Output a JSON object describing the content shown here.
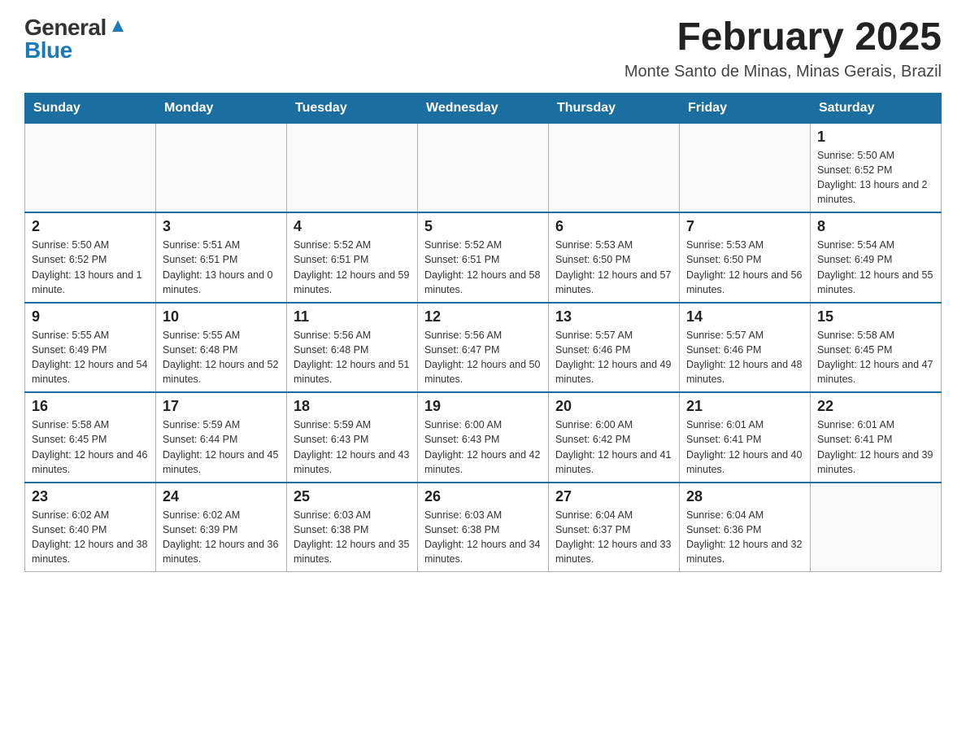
{
  "logo": {
    "general": "General",
    "blue": "Blue"
  },
  "title": "February 2025",
  "location": "Monte Santo de Minas, Minas Gerais, Brazil",
  "days_of_week": [
    "Sunday",
    "Monday",
    "Tuesday",
    "Wednesday",
    "Thursday",
    "Friday",
    "Saturday"
  ],
  "weeks": [
    [
      {
        "day": "",
        "info": ""
      },
      {
        "day": "",
        "info": ""
      },
      {
        "day": "",
        "info": ""
      },
      {
        "day": "",
        "info": ""
      },
      {
        "day": "",
        "info": ""
      },
      {
        "day": "",
        "info": ""
      },
      {
        "day": "1",
        "info": "Sunrise: 5:50 AM\nSunset: 6:52 PM\nDaylight: 13 hours and 2 minutes."
      }
    ],
    [
      {
        "day": "2",
        "info": "Sunrise: 5:50 AM\nSunset: 6:52 PM\nDaylight: 13 hours and 1 minute."
      },
      {
        "day": "3",
        "info": "Sunrise: 5:51 AM\nSunset: 6:51 PM\nDaylight: 13 hours and 0 minutes."
      },
      {
        "day": "4",
        "info": "Sunrise: 5:52 AM\nSunset: 6:51 PM\nDaylight: 12 hours and 59 minutes."
      },
      {
        "day": "5",
        "info": "Sunrise: 5:52 AM\nSunset: 6:51 PM\nDaylight: 12 hours and 58 minutes."
      },
      {
        "day": "6",
        "info": "Sunrise: 5:53 AM\nSunset: 6:50 PM\nDaylight: 12 hours and 57 minutes."
      },
      {
        "day": "7",
        "info": "Sunrise: 5:53 AM\nSunset: 6:50 PM\nDaylight: 12 hours and 56 minutes."
      },
      {
        "day": "8",
        "info": "Sunrise: 5:54 AM\nSunset: 6:49 PM\nDaylight: 12 hours and 55 minutes."
      }
    ],
    [
      {
        "day": "9",
        "info": "Sunrise: 5:55 AM\nSunset: 6:49 PM\nDaylight: 12 hours and 54 minutes."
      },
      {
        "day": "10",
        "info": "Sunrise: 5:55 AM\nSunset: 6:48 PM\nDaylight: 12 hours and 52 minutes."
      },
      {
        "day": "11",
        "info": "Sunrise: 5:56 AM\nSunset: 6:48 PM\nDaylight: 12 hours and 51 minutes."
      },
      {
        "day": "12",
        "info": "Sunrise: 5:56 AM\nSunset: 6:47 PM\nDaylight: 12 hours and 50 minutes."
      },
      {
        "day": "13",
        "info": "Sunrise: 5:57 AM\nSunset: 6:46 PM\nDaylight: 12 hours and 49 minutes."
      },
      {
        "day": "14",
        "info": "Sunrise: 5:57 AM\nSunset: 6:46 PM\nDaylight: 12 hours and 48 minutes."
      },
      {
        "day": "15",
        "info": "Sunrise: 5:58 AM\nSunset: 6:45 PM\nDaylight: 12 hours and 47 minutes."
      }
    ],
    [
      {
        "day": "16",
        "info": "Sunrise: 5:58 AM\nSunset: 6:45 PM\nDaylight: 12 hours and 46 minutes."
      },
      {
        "day": "17",
        "info": "Sunrise: 5:59 AM\nSunset: 6:44 PM\nDaylight: 12 hours and 45 minutes."
      },
      {
        "day": "18",
        "info": "Sunrise: 5:59 AM\nSunset: 6:43 PM\nDaylight: 12 hours and 43 minutes."
      },
      {
        "day": "19",
        "info": "Sunrise: 6:00 AM\nSunset: 6:43 PM\nDaylight: 12 hours and 42 minutes."
      },
      {
        "day": "20",
        "info": "Sunrise: 6:00 AM\nSunset: 6:42 PM\nDaylight: 12 hours and 41 minutes."
      },
      {
        "day": "21",
        "info": "Sunrise: 6:01 AM\nSunset: 6:41 PM\nDaylight: 12 hours and 40 minutes."
      },
      {
        "day": "22",
        "info": "Sunrise: 6:01 AM\nSunset: 6:41 PM\nDaylight: 12 hours and 39 minutes."
      }
    ],
    [
      {
        "day": "23",
        "info": "Sunrise: 6:02 AM\nSunset: 6:40 PM\nDaylight: 12 hours and 38 minutes."
      },
      {
        "day": "24",
        "info": "Sunrise: 6:02 AM\nSunset: 6:39 PM\nDaylight: 12 hours and 36 minutes."
      },
      {
        "day": "25",
        "info": "Sunrise: 6:03 AM\nSunset: 6:38 PM\nDaylight: 12 hours and 35 minutes."
      },
      {
        "day": "26",
        "info": "Sunrise: 6:03 AM\nSunset: 6:38 PM\nDaylight: 12 hours and 34 minutes."
      },
      {
        "day": "27",
        "info": "Sunrise: 6:04 AM\nSunset: 6:37 PM\nDaylight: 12 hours and 33 minutes."
      },
      {
        "day": "28",
        "info": "Sunrise: 6:04 AM\nSunset: 6:36 PM\nDaylight: 12 hours and 32 minutes."
      },
      {
        "day": "",
        "info": ""
      }
    ]
  ]
}
